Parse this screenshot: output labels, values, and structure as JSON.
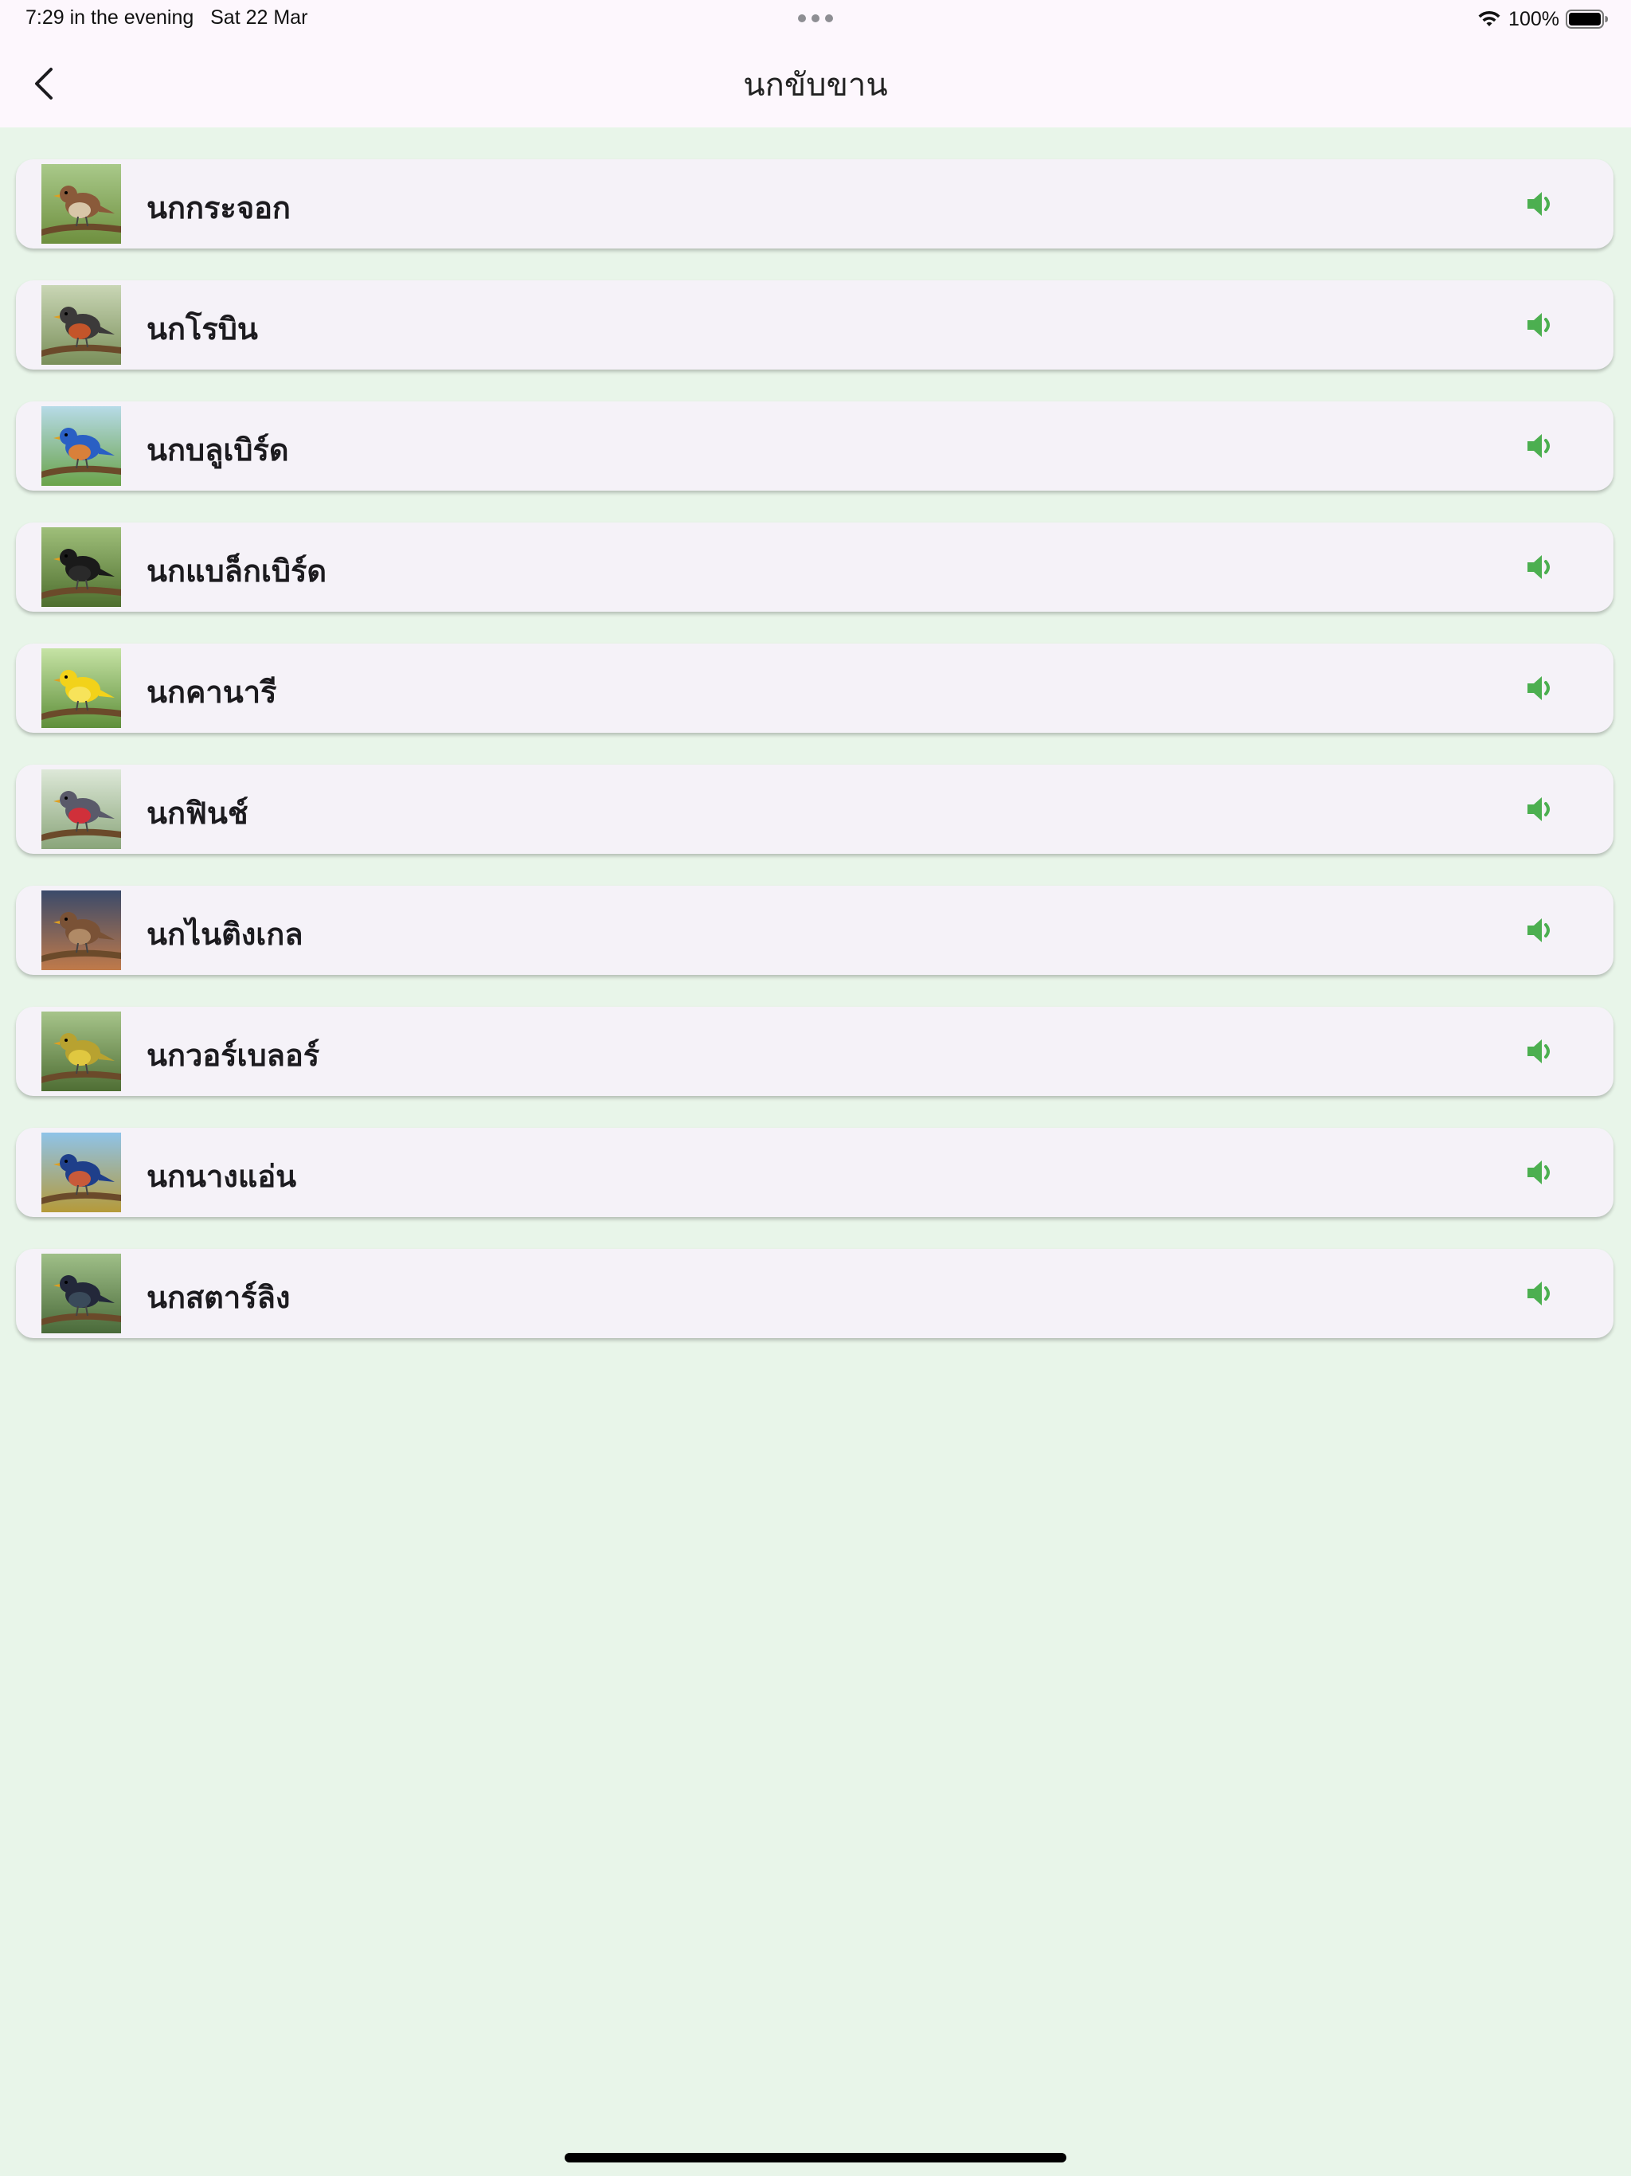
{
  "status_bar": {
    "time": "7:29 in the evening",
    "date": "Sat 22 Mar",
    "battery": "100%",
    "wifi_icon": "wifi-icon",
    "battery_icon": "battery-icon"
  },
  "nav": {
    "title": "นกขับขาน",
    "back_icon": "chevron-left-icon"
  },
  "colors": {
    "background": "#e8f5e9",
    "header": "#fdf7fd",
    "card": "#f5f2f8",
    "accent": "#4caf50"
  },
  "birds": [
    {
      "name": "นกกระจอก",
      "image_icon": "sparrow-image",
      "bird_color": "#8a5a3a",
      "breast_color": "#d8c6a8",
      "bg_top": "#a9c98a",
      "bg_bottom": "#6e8f3e",
      "sound_icon": "speaker-icon"
    },
    {
      "name": "นกโรบิน",
      "image_icon": "robin-image",
      "bird_color": "#3c3a3a",
      "breast_color": "#c4552a",
      "bg_top": "#c9d6b5",
      "bg_bottom": "#7a8f5a",
      "sound_icon": "speaker-icon"
    },
    {
      "name": "นกบลูเบิร์ด",
      "image_icon": "bluebird-image",
      "bird_color": "#2a5fc4",
      "breast_color": "#d9803a",
      "bg_top": "#b7dbe8",
      "bg_bottom": "#6aa34a",
      "sound_icon": "speaker-icon"
    },
    {
      "name": "นกแบล็กเบิร์ด",
      "image_icon": "blackbird-image",
      "bird_color": "#1a1a1a",
      "breast_color": "#2a2a2a",
      "bg_top": "#9fbf7a",
      "bg_bottom": "#4e6e2e",
      "sound_icon": "speaker-icon"
    },
    {
      "name": "นกคานารี",
      "image_icon": "canary-image",
      "bird_color": "#f2d21a",
      "breast_color": "#f7e35a",
      "bg_top": "#c6e3a5",
      "bg_bottom": "#5f8f3a",
      "sound_icon": "speaker-icon"
    },
    {
      "name": "นกฟินช์",
      "image_icon": "finch-image",
      "bird_color": "#5a5a6a",
      "breast_color": "#d0303a",
      "bg_top": "#dde8d8",
      "bg_bottom": "#8aa57a",
      "sound_icon": "speaker-icon"
    },
    {
      "name": "นกไนติงเกล",
      "image_icon": "nightingale-image",
      "bird_color": "#7a5236",
      "breast_color": "#b08a66",
      "bg_top": "#3a4a6a",
      "bg_bottom": "#c07a4a",
      "sound_icon": "speaker-icon"
    },
    {
      "name": "นกวอร์เบลอร์",
      "image_icon": "warbler-image",
      "bird_color": "#b8a230",
      "breast_color": "#e0c840",
      "bg_top": "#a6c48a",
      "bg_bottom": "#4f6e34",
      "sound_icon": "speaker-icon"
    },
    {
      "name": "นกนางแอ่น",
      "image_icon": "swallow-image",
      "bird_color": "#1f3f8a",
      "breast_color": "#c85a3a",
      "bg_top": "#8fc3e8",
      "bg_bottom": "#b59a3a",
      "sound_icon": "speaker-icon"
    },
    {
      "name": "นกสตาร์ลิง",
      "image_icon": "starling-image",
      "bird_color": "#23283a",
      "breast_color": "#3a4a5a",
      "bg_top": "#9fbf88",
      "bg_bottom": "#4a6a3a",
      "sound_icon": "speaker-icon"
    }
  ]
}
